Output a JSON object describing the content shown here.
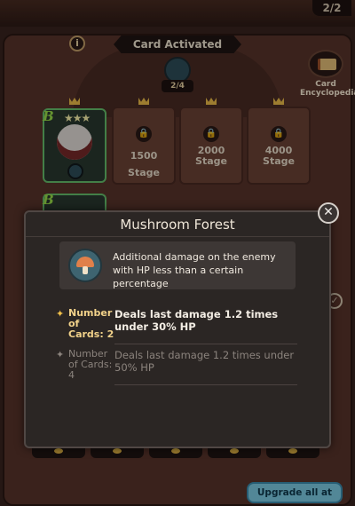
{
  "header": {
    "counter": "2/2",
    "banner_title": "Card Activated",
    "info_icon": "i",
    "progress": "2/4",
    "encyclopedia_label": "Card Encyclopedia"
  },
  "cards": {
    "grade": "B",
    "slots": [
      {
        "stage": "1500 Stage"
      },
      {
        "stage": "2000 Stage"
      },
      {
        "stage": "4000 Stage"
      }
    ]
  },
  "modal": {
    "title": "Mushroom Forest",
    "description": "Additional damage on the enemy with HP less than a certain percentage",
    "effects": [
      {
        "count_label": "Number of Cards: 2",
        "detail": "Deals last damage 1.2 times under 30% HP",
        "active": true
      },
      {
        "count_label": "Number of Cards: 4",
        "detail": "Deals last damage 1.2 times under 50% HP",
        "active": false
      }
    ]
  },
  "footer": {
    "upgrade_label": "Upgrade all at once"
  },
  "colors": {
    "accent_active": "#f2c14a",
    "button": "#7fd0e8",
    "grade_green": "#9be24b"
  }
}
